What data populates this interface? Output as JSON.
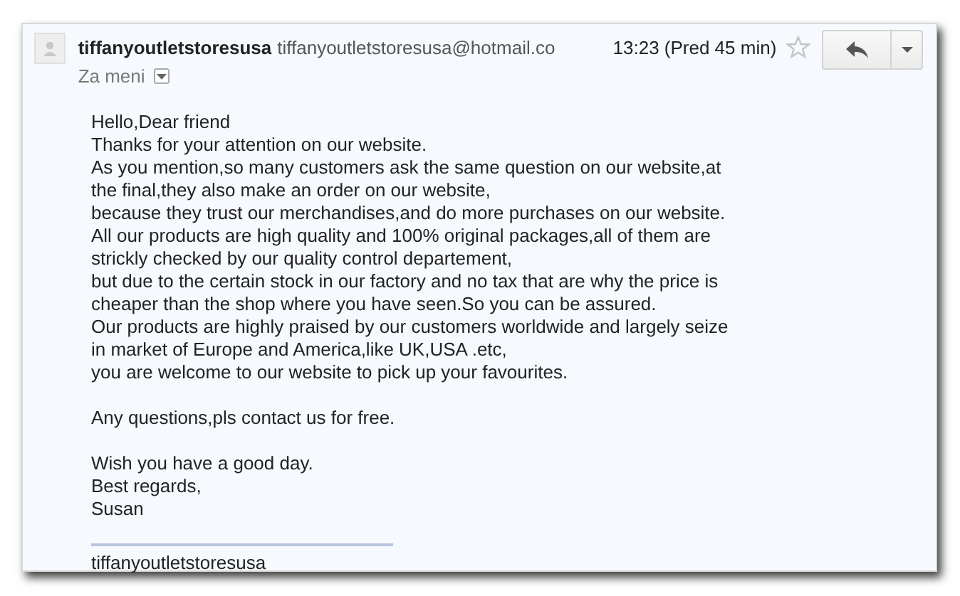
{
  "header": {
    "sender_name": "tiffanyoutletstoresusa",
    "sender_email": "tiffanyoutletstoresusa@hotmail.co",
    "time": "13:23 (Pred 45 min)",
    "starred": false,
    "recipient_label": "Za meni"
  },
  "body": {
    "paragraphs": [
      [
        "Hello,Dear friend",
        "Thanks for your attention on our website.",
        "As you mention,so many customers ask the same question on our website,at",
        "the final,they also make an order on our website,",
        "because they trust our merchandises,and do more purchases on our website.",
        "All our products are high quality and 100% original packages,all of them are",
        "strickly checked by our quality control departement,",
        "but due to the certain stock in our factory and no tax that are why the price is",
        "cheaper than the shop where you have seen.So you can be assured.",
        "Our products are highly praised by our customers worldwide and largely seize",
        "in market of Europe and America,like UK,USA .etc,",
        "you are welcome to our website to pick up your favourites."
      ],
      [
        "Any questions,pls contact us for free."
      ],
      [
        "Wish you have a good day.",
        "Best regards,",
        "Susan"
      ]
    ]
  },
  "signature": "tiffanyoutletstoresusa"
}
